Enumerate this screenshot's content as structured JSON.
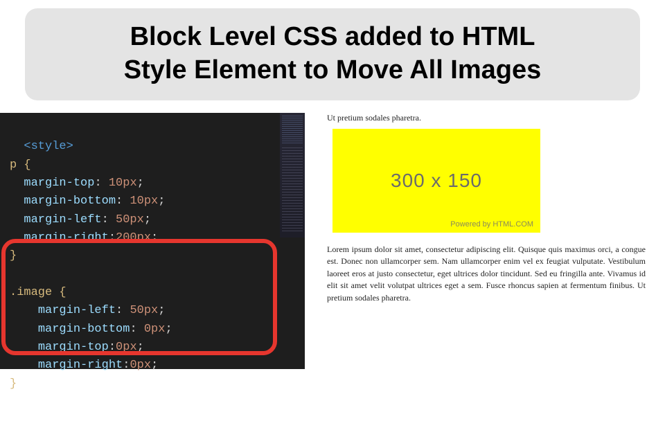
{
  "title": {
    "line1": "Block Level CSS added to HTML",
    "line2": "Style Element to Move All Images"
  },
  "editor": {
    "open_tag": "<style>",
    "selector_p": "p {",
    "p_rules": {
      "r1": {
        "prop": "margin-top",
        "val": "10px"
      },
      "r2": {
        "prop": "margin-bottom",
        "val": "10px"
      },
      "r3": {
        "prop": "margin-left",
        "val": "50px"
      },
      "r4": {
        "prop": "margin-right",
        "val": "200px"
      }
    },
    "close_p": "}",
    "selector_img": ".image {",
    "img_rules": {
      "r1": {
        "prop": "margin-left",
        "val": "50px"
      },
      "r2": {
        "prop": "margin-bottom",
        "val": "0px"
      },
      "r3": {
        "prop": "margin-top",
        "val": "0px"
      },
      "r4": {
        "prop": "margin-right",
        "val": "0px"
      }
    },
    "close_img": "}"
  },
  "preview": {
    "top_text": "Ut pretium sodales pharetra.",
    "placeholder": {
      "dimensions": "300 x 150",
      "powered": "Powered by HTML.COM"
    },
    "lorem": "Lorem ipsum dolor sit amet, consectetur adipiscing elit. Quisque quis maximus orci, a congue est. Donec non ullamcorper sem. Nam ullamcorper enim vel ex feugiat vulputate. Vestibulum laoreet eros at justo consectetur, eget ultrices dolor tincidunt. Sed eu fringilla ante. Vivamus id elit sit amet velit volutpat ultrices eget a sem. Fusce rhoncus sapien at fermentum finibus. Ut pretium sodales pharetra."
  },
  "colors": {
    "highlight": "#e6362e",
    "editor_bg": "#1e1e1e",
    "title_bg": "#e4e4e4",
    "placeholder_bg": "#ffff00"
  }
}
